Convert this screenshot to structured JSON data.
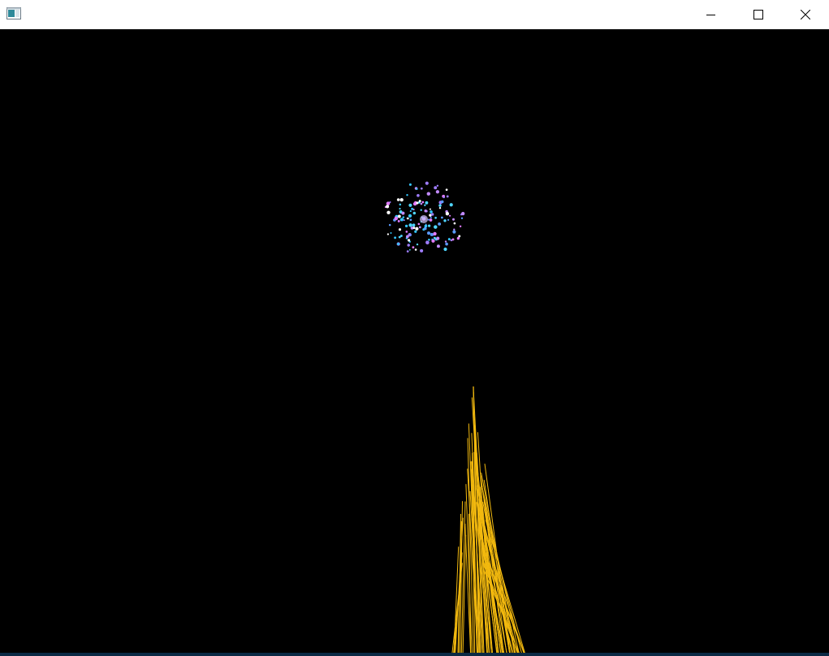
{
  "window": {
    "title": "",
    "controls": {
      "minimize": "minimize-icon",
      "maximize": "maximize-icon",
      "close": "close-icon"
    }
  },
  "scene": {
    "background_color": "#000000",
    "firework_burst": {
      "palette": [
        "#4fd6ff",
        "#5a9bff",
        "#c38bff",
        "#e27cff",
        "#9f7dff",
        "#ffffff",
        "#35c7ff"
      ]
    },
    "rocket_trail": {
      "color": "#f2b90f"
    }
  }
}
